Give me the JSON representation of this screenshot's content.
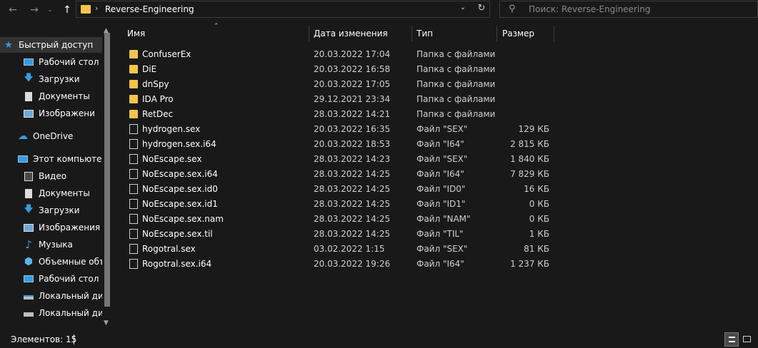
{
  "nav": {
    "back_icon": "arrow-left",
    "forward_icon": "arrow-right",
    "recent_icon": "chevron-down",
    "up_icon": "arrow-up",
    "breadcrumb": "Reverse-Engineering",
    "search_placeholder": "Поиск: Reverse-Engineering"
  },
  "sidebar": {
    "items": [
      {
        "label": "Быстрый доступ",
        "icon": "star-icon",
        "pinned": false,
        "active": true
      },
      {
        "label": "Рабочий стол",
        "icon": "desktop-icon",
        "pinned": true
      },
      {
        "label": "Загрузки",
        "icon": "download-icon",
        "pinned": true
      },
      {
        "label": "Документы",
        "icon": "document-icon",
        "pinned": true
      },
      {
        "label": "Изображени",
        "icon": "pictures-icon",
        "pinned": true
      },
      {
        "label": "OneDrive",
        "icon": "cloud-icon",
        "pinned": false
      },
      {
        "label": "Этот компьютер",
        "icon": "computer-icon",
        "pinned": false
      },
      {
        "label": "Видео",
        "icon": "video-icon",
        "pinned": false
      },
      {
        "label": "Документы",
        "icon": "document-icon",
        "pinned": false
      },
      {
        "label": "Загрузки",
        "icon": "download-icon",
        "pinned": false
      },
      {
        "label": "Изображения",
        "icon": "pictures-icon",
        "pinned": false
      },
      {
        "label": "Музыка",
        "icon": "music-icon",
        "pinned": false
      },
      {
        "label": "Объемные объ",
        "icon": "3d-objects-icon",
        "pinned": false
      },
      {
        "label": "Рабочий стол",
        "icon": "desktop-icon",
        "pinned": false
      },
      {
        "label": "Локальный дис",
        "icon": "drive-icon",
        "pinned": false
      },
      {
        "label": "Локальный дис",
        "icon": "drive-icon",
        "pinned": false
      }
    ]
  },
  "columns": {
    "name": "Имя",
    "date": "Дата изменения",
    "type": "Тип",
    "size": "Размер"
  },
  "files": [
    {
      "name": "ConfuserEx",
      "date": "20.03.2022 17:04",
      "type": "Папка с файлами",
      "size": "",
      "kind": "folder"
    },
    {
      "name": "DiE",
      "date": "20.03.2022 16:58",
      "type": "Папка с файлами",
      "size": "",
      "kind": "folder"
    },
    {
      "name": "dnSpy",
      "date": "20.03.2022 17:05",
      "type": "Папка с файлами",
      "size": "",
      "kind": "folder"
    },
    {
      "name": "IDA Pro",
      "date": "29.12.2021 23:34",
      "type": "Папка с файлами",
      "size": "",
      "kind": "folder"
    },
    {
      "name": "RetDec",
      "date": "28.03.2022 14:21",
      "type": "Папка с файлами",
      "size": "",
      "kind": "folder"
    },
    {
      "name": "hydrogen.sex",
      "date": "20.03.2022 16:35",
      "type": "Файл \"SEX\"",
      "size": "129 КБ",
      "kind": "file"
    },
    {
      "name": "hydrogen.sex.i64",
      "date": "20.03.2022 18:53",
      "type": "Файл \"I64\"",
      "size": "2 815 КБ",
      "kind": "file"
    },
    {
      "name": "NoEscape.sex",
      "date": "28.03.2022 14:23",
      "type": "Файл \"SEX\"",
      "size": "1 840 КБ",
      "kind": "file"
    },
    {
      "name": "NoEscape.sex.i64",
      "date": "28.03.2022 14:25",
      "type": "Файл \"I64\"",
      "size": "7 829 КБ",
      "kind": "file"
    },
    {
      "name": "NoEscape.sex.id0",
      "date": "28.03.2022 14:25",
      "type": "Файл \"ID0\"",
      "size": "16 КБ",
      "kind": "file"
    },
    {
      "name": "NoEscape.sex.id1",
      "date": "28.03.2022 14:25",
      "type": "Файл \"ID1\"",
      "size": "0 КБ",
      "kind": "file"
    },
    {
      "name": "NoEscape.sex.nam",
      "date": "28.03.2022 14:25",
      "type": "Файл \"NAM\"",
      "size": "0 КБ",
      "kind": "file"
    },
    {
      "name": "NoEscape.sex.til",
      "date": "28.03.2022 14:25",
      "type": "Файл \"TIL\"",
      "size": "1 КБ",
      "kind": "file"
    },
    {
      "name": "Rogotral.sex",
      "date": "03.02.2022 1:15",
      "type": "Файл \"SEX\"",
      "size": "81 КБ",
      "kind": "file"
    },
    {
      "name": "Rogotral.sex.i64",
      "date": "20.03.2022 19:26",
      "type": "Файл \"I64\"",
      "size": "1 237 КБ",
      "kind": "file"
    }
  ],
  "status": {
    "count": "Элементов: 15"
  },
  "colors": {
    "background": "#191919",
    "folder": "#f5c54a",
    "accent_blue": "#3a9be0",
    "selected": "#333333"
  }
}
